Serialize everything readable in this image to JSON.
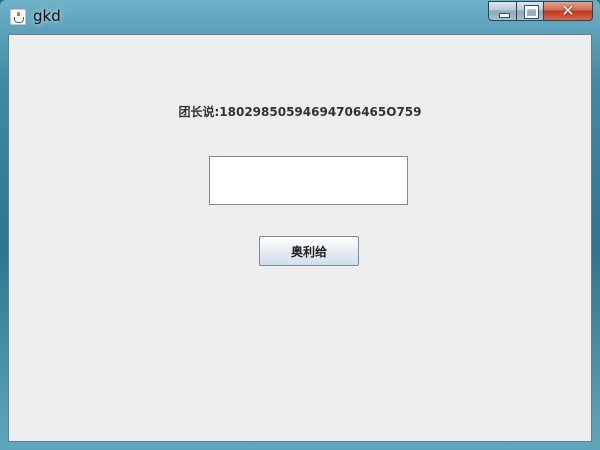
{
  "window": {
    "title": "gkd",
    "icons": {
      "app": "java-cup-icon",
      "minimize": "minimize-icon",
      "maximize": "maximize-icon",
      "close": "close-icon"
    },
    "close_glyph": "✕"
  },
  "content": {
    "message": "团长说:18029850594694706465O759",
    "input_value": "",
    "button_label": "奥利给"
  }
}
